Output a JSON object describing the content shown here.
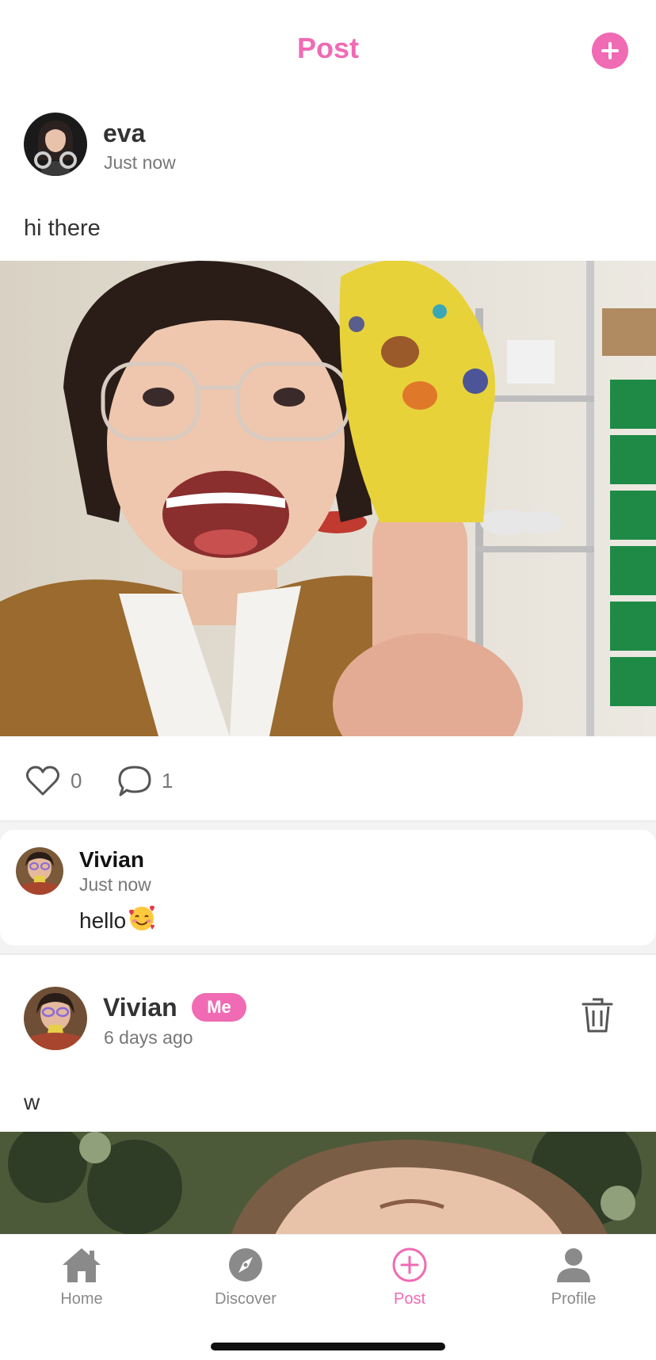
{
  "header": {
    "title": "Post",
    "add_icon": "plus-circle-icon",
    "accent": "#f06ab4"
  },
  "posts": [
    {
      "author": "eva",
      "time": "Just now",
      "text": "hi there",
      "likes": "0",
      "comments": "1",
      "comment_list": [
        {
          "author": "Vivian",
          "time": "Just now",
          "text": "hello",
          "emoji": "smiling-face-with-hearts"
        }
      ]
    },
    {
      "author": "Vivian",
      "badge": "Me",
      "time": "6 days ago",
      "text": "w"
    }
  ],
  "tabbar": {
    "items": [
      {
        "label": "Home",
        "icon": "home-icon"
      },
      {
        "label": "Discover",
        "icon": "compass-icon"
      },
      {
        "label": "Post",
        "icon": "plus-circle-icon",
        "active": true
      },
      {
        "label": "Profile",
        "icon": "person-icon"
      }
    ]
  }
}
